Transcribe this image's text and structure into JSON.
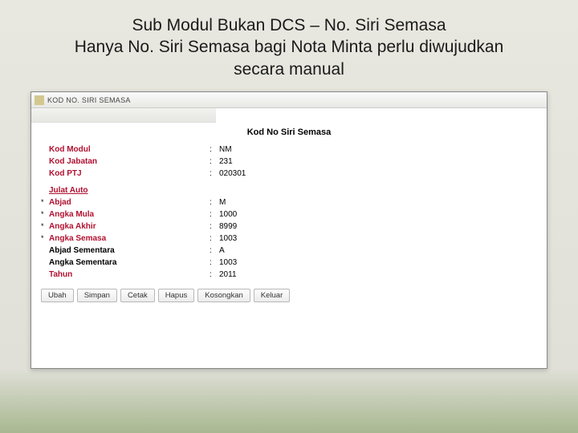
{
  "slide": {
    "title_line1": "Sub Modul Bukan DCS – No. Siri Semasa",
    "title_line2": "Hanya No. Siri Semasa bagi Nota Minta perlu diwujudkan",
    "title_line3": "secara manual"
  },
  "window": {
    "title": "KOD NO. SIRI SEMASA",
    "content_title": "Kod No Siri Semasa",
    "top_fields": [
      {
        "label": "Kod Modul",
        "value": "NM"
      },
      {
        "label": "Kod Jabatan",
        "value": "231"
      },
      {
        "label": "Kod PTJ",
        "value": "020301"
      }
    ],
    "section_head": "Julat Auto",
    "section_fields": [
      {
        "marker": "*",
        "label": "Abjad",
        "style": "red",
        "value": "M"
      },
      {
        "marker": "*",
        "label": "Angka Mula",
        "style": "red",
        "value": "1000"
      },
      {
        "marker": "*",
        "label": "Angka Akhir",
        "style": "red",
        "value": "8999"
      },
      {
        "marker": "*",
        "label": "Angka Semasa",
        "style": "red",
        "value": "1003"
      },
      {
        "marker": "",
        "label": "Abjad Sementara",
        "style": "black",
        "value": "A"
      },
      {
        "marker": "",
        "label": "Angka Sementara",
        "style": "black",
        "value": "1003"
      },
      {
        "marker": "",
        "label": "Tahun",
        "style": "red",
        "value": "2011"
      }
    ],
    "buttons": {
      "ubah": "Ubah",
      "simpan": "Simpan",
      "cetak": "Cetak",
      "hapus": "Hapus",
      "kosongkan": "Kosongkan",
      "keluar": "Keluar"
    }
  }
}
